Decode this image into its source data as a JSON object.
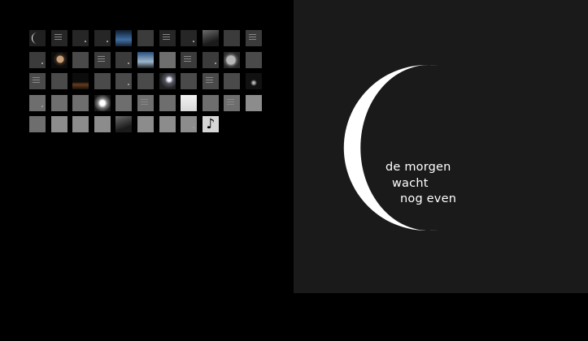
{
  "thumbnails": {
    "count": 53,
    "special_glyph": "♪",
    "moon_icon": "crescent-moon-icon",
    "note_icon": "music-note-icon"
  },
  "viewer": {
    "poem_lines": [
      "de morgen",
      "wacht",
      "nog even"
    ],
    "text_color": "#ffffff",
    "background": "#1a1a1a",
    "moon_color": "#ffffff"
  }
}
